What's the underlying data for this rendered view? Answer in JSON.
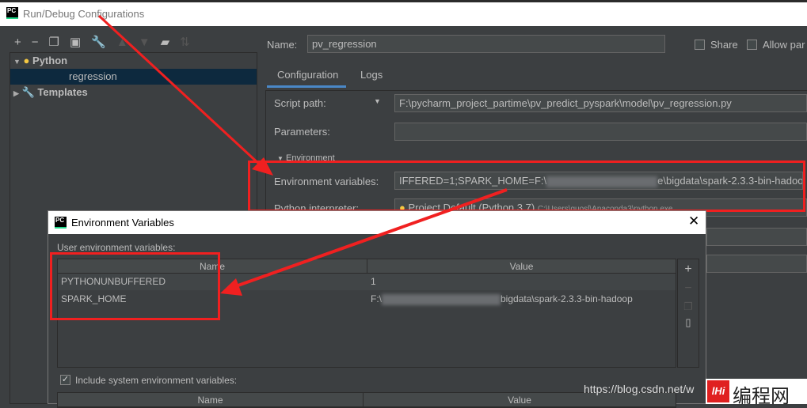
{
  "window": {
    "title": "Run/Debug Configurations",
    "icon": "pycharm-icon"
  },
  "toolbar": {
    "icons": [
      "plus-icon",
      "minus-icon",
      "copy-icon",
      "save-icon",
      "wrench-icon",
      "arrow-up-icon",
      "arrow-down-icon",
      "folder-add-icon",
      "sort-icon"
    ]
  },
  "tree": {
    "python": "Python",
    "config": "regression",
    "templates": "Templates"
  },
  "form": {
    "name_label": "Name:",
    "name_value": "pv_regression",
    "share": "Share",
    "allow": "Allow par",
    "tabs": [
      "Configuration",
      "Logs"
    ],
    "script_label": "Script path:",
    "script_value": "F:\\pycharm_project_partime\\pv_predict_pyspark\\model\\pv_regression.py",
    "params_label": "Parameters:",
    "env_section": "Environment",
    "env_label": "Environment variables:",
    "env_value_a": "IFFERED=1;SPARK_HOME=F:\\",
    "env_value_b": "e\\bigdata\\spark-2.3.3-bin-hadoop",
    "interp_label": "Python interpreter:",
    "interp_value": "Project Default (Python 3.7)",
    "interp_path": "C:\\Users\\guosl\\Anaconda3\\python.exe"
  },
  "dialog": {
    "title": "Environment Variables",
    "user_label": "User environment variables:",
    "columns": [
      "Name",
      "Value"
    ],
    "rows": [
      {
        "name": "PYTHONUNBUFFERED",
        "value": "1"
      },
      {
        "name": "SPARK_HOME",
        "value_a": "F:\\",
        "value_b": "bigdata\\spark-2.3.3-bin-hadoop"
      }
    ],
    "include_label": "Include system environment variables:",
    "include_checked": true,
    "sys_columns": [
      "Name",
      "Value"
    ]
  },
  "watermark": {
    "url": "https://blog.csdn.net/w",
    "logo": "编程网"
  },
  "colors": {
    "annotation": "#f02020",
    "selection": "#0d293e",
    "tab_underline": "#4a88c7"
  }
}
